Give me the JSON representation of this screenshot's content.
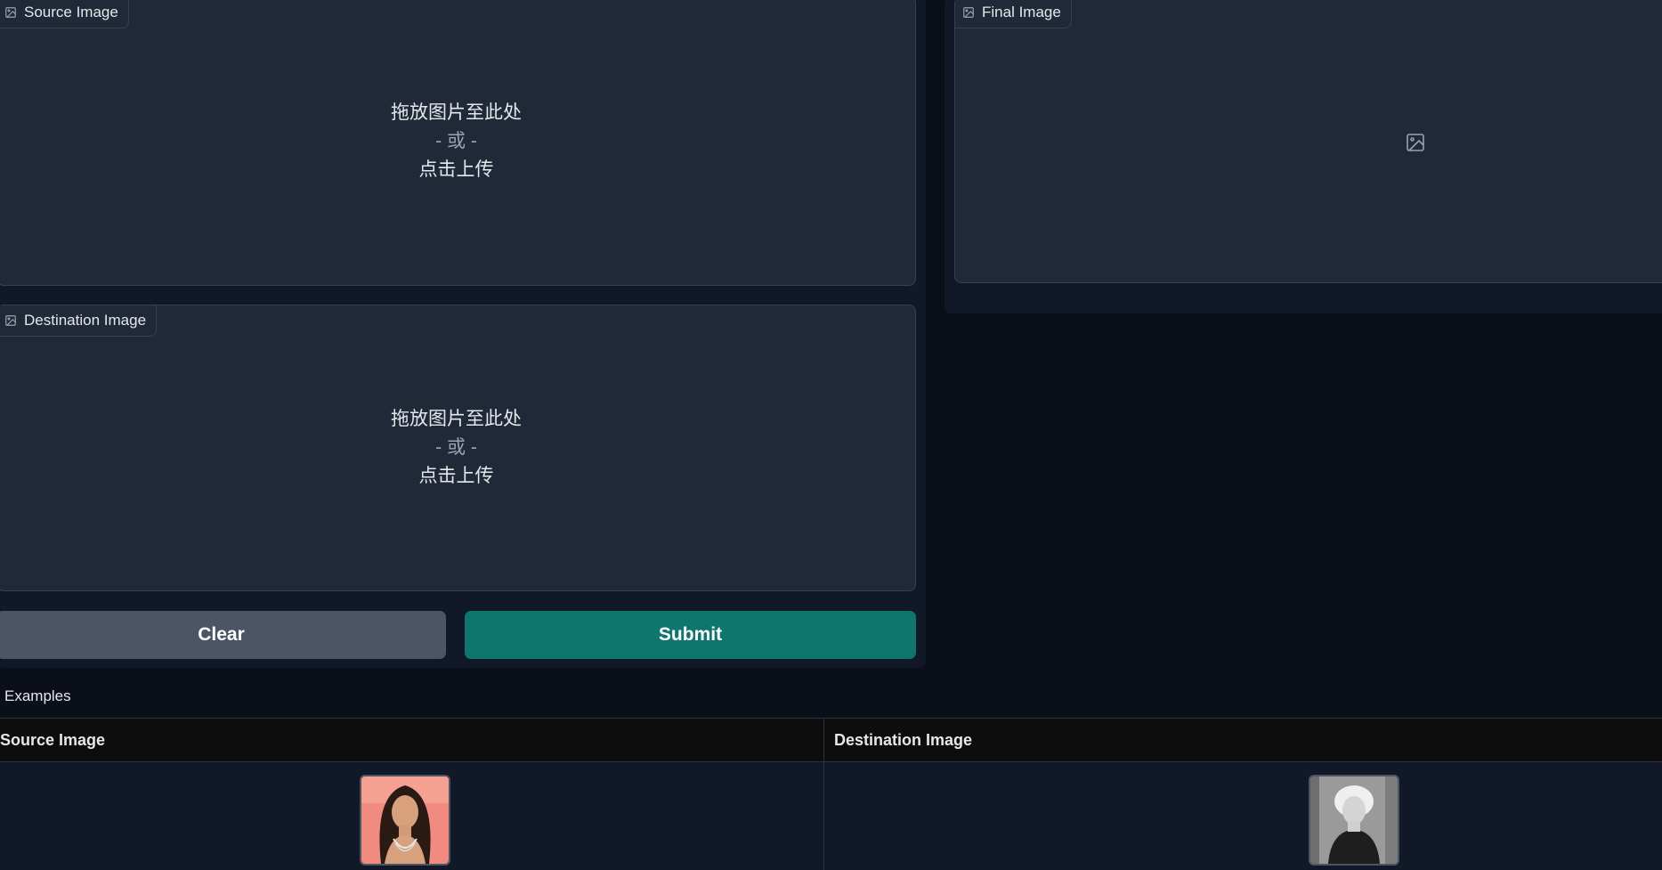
{
  "source_block": {
    "label": "Source Image",
    "icon": "image-icon",
    "upload": {
      "line1": "拖放图片至此处",
      "or": "- 或 -",
      "line2": "点击上传"
    }
  },
  "destination_block": {
    "label": "Destination Image",
    "icon": "image-icon",
    "upload": {
      "line1": "拖放图片至此处",
      "or": "- 或 -",
      "line2": "点击上传"
    }
  },
  "final_block": {
    "label": "Final Image",
    "icon": "image-icon",
    "placeholder_icon": "image-placeholder-icon"
  },
  "buttons": {
    "clear": "Clear",
    "submit": "Submit"
  },
  "examples": {
    "label": "Examples",
    "columns": [
      "Source Image",
      "Destination Image"
    ]
  },
  "colors": {
    "background": "#0b0f19",
    "panel": "#111827",
    "block": "#1f2937",
    "clear_button": "#4b5563",
    "submit_button": "#0f766e"
  }
}
